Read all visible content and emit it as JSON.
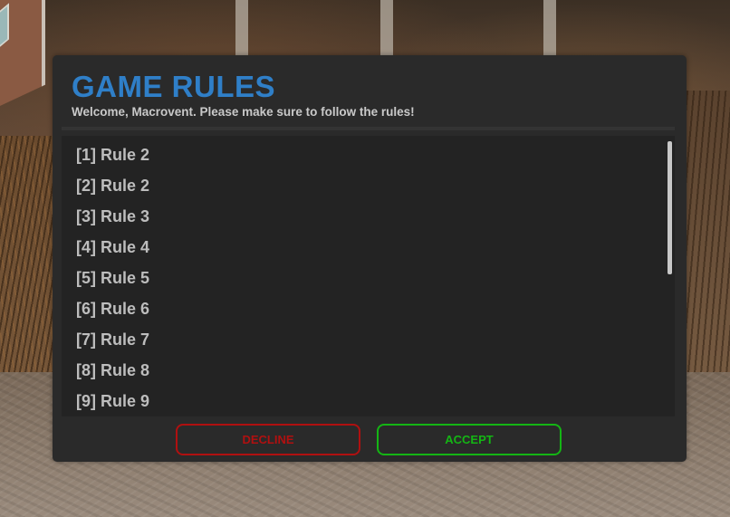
{
  "dialog": {
    "title": "GAME RULES",
    "subtitle": "Welcome, Macrovent. Please make sure to follow the rules!",
    "title_color": "#2f7fc8"
  },
  "rules": [
    "[1] Rule 2",
    "[2] Rule 2",
    "[3] Rule 3",
    "[4] Rule 4",
    "[5] Rule 5",
    "[6] Rule 6",
    "[7] Rule 7",
    "[8] Rule 8",
    "[9] Rule 9"
  ],
  "buttons": {
    "decline_label": "DECLINE",
    "accept_label": "ACCEPT",
    "decline_color": "#b01010",
    "accept_color": "#14b514"
  }
}
